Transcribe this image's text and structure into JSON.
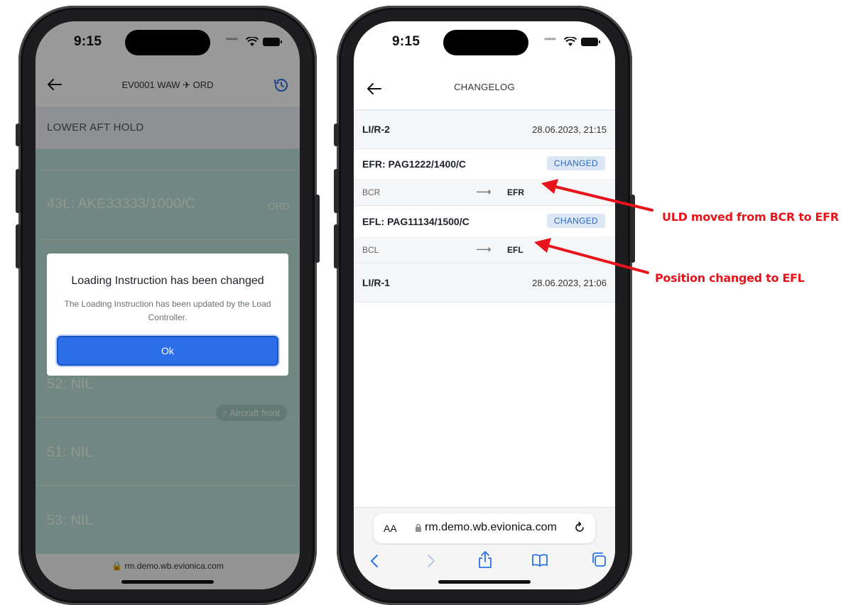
{
  "left_phone": {
    "status_time": "9:15",
    "header": {
      "title": "EV0001 WAW ✈ ORD"
    },
    "section_title": "LOWER AFT HOLD",
    "rows": [
      {
        "label": "43L: AKE33333/1000/C",
        "dest": "ORD"
      },
      {
        "label": "52: NIL",
        "dest": ""
      },
      {
        "label": "51: NIL",
        "dest": ""
      },
      {
        "label": "53: NIL",
        "dest": ""
      }
    ],
    "aircraft_front_label": "↑ Aircraft front",
    "url": "rm.demo.wb.evionica.com",
    "dialog": {
      "title": "Loading Instruction has been changed",
      "message": "The Loading Instruction has been updated by the Load Controller.",
      "ok_label": "Ok"
    }
  },
  "right_phone": {
    "status_time": "9:15",
    "header": {
      "title": "CHANGELOG"
    },
    "groups": [
      {
        "id": "LI/R-2",
        "time": "28.06.2023, 21:15",
        "items": [
          {
            "name": "EFR: PAG1222/1400/C",
            "badge": "CHANGED",
            "from": "BCR",
            "to": "EFR"
          },
          {
            "name": "EFL: PAG11134/1500/C",
            "badge": "CHANGED",
            "from": "BCL",
            "to": "EFL"
          }
        ]
      },
      {
        "id": "LI/R-1",
        "time": "28.06.2023, 21:06",
        "items": []
      }
    ],
    "safari": {
      "aa_label": "AA",
      "url": "rm.demo.wb.evionica.com"
    }
  },
  "annotations": {
    "first": "ULD moved from BCR to EFR",
    "second": "Position changed to EFL",
    "color": "#e8141b"
  },
  "colors": {
    "primary_button": "#2b6ee8",
    "badge_bg": "#dce7f6",
    "badge_text": "#2f68c2",
    "hold_green": "#bde2d9"
  }
}
